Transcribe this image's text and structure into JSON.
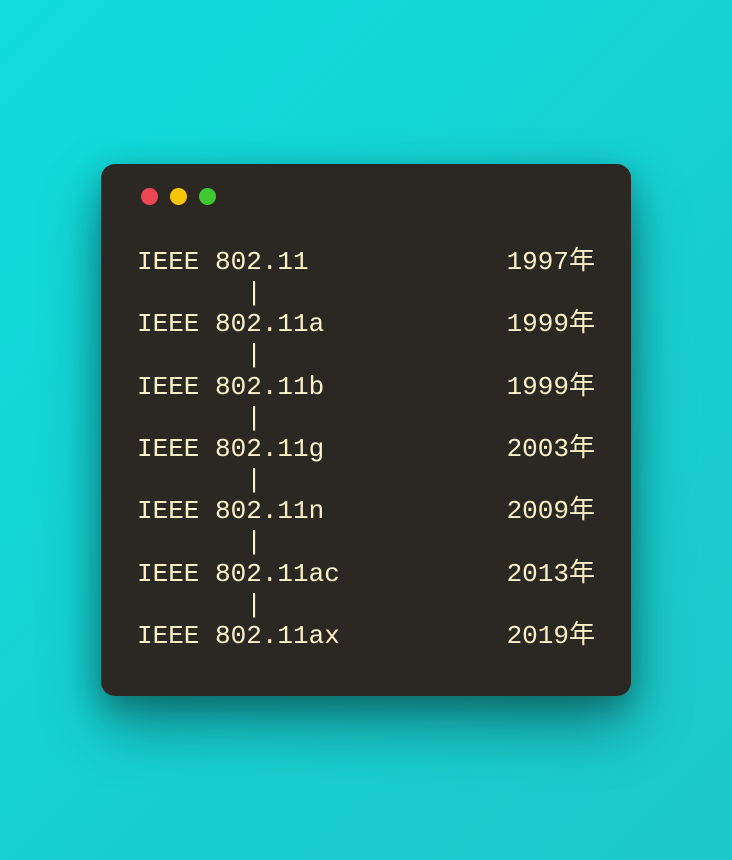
{
  "window": {
    "traffic_lights": {
      "close": "close",
      "minimize": "minimize",
      "maximize": "maximize"
    }
  },
  "connector": "       |",
  "standards": [
    {
      "name": "IEEE 802.11",
      "year": "1997年"
    },
    {
      "name": "IEEE 802.11a",
      "year": "1999年"
    },
    {
      "name": "IEEE 802.11b",
      "year": "1999年"
    },
    {
      "name": "IEEE 802.11g",
      "year": "2003年"
    },
    {
      "name": "IEEE 802.11n",
      "year": "2009年"
    },
    {
      "name": "IEEE 802.11ac",
      "year": "2013年"
    },
    {
      "name": "IEEE 802.11ax",
      "year": "2019年"
    }
  ]
}
